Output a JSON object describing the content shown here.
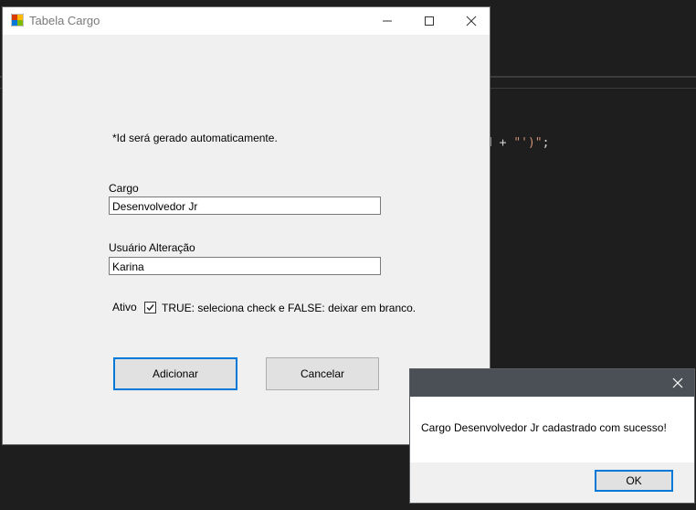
{
  "editor": {
    "code_prefix": "d + ",
    "code_string": "\"')\"",
    "code_suffix": ";"
  },
  "window": {
    "title": "Tabela Cargo",
    "icons": {
      "app": "app-form-icon",
      "minimize": "minimize-icon",
      "maximize": "maximize-icon",
      "close": "close-icon"
    }
  },
  "form": {
    "note": "*Id será gerado automaticamente.",
    "cargo_label": "Cargo",
    "cargo_value": "Desenvolvedor Jr",
    "usuario_label": "Usuário Alteração",
    "usuario_value": "Karina",
    "ativo_label": "Ativo",
    "ativo_checked": true,
    "ativo_hint": "TRUE: seleciona check e FALSE: deixar em branco.",
    "add_button": "Adicionar",
    "cancel_button": "Cancelar"
  },
  "message_box": {
    "text": "Cargo Desenvolvedor Jr cadastrado com sucesso!",
    "ok_button": "OK"
  },
  "colors": {
    "accent": "#0078d7",
    "editor_bg": "#1e1e1e",
    "form_bg": "#f0f0f0",
    "msg_titlebar": "#4a5055"
  }
}
